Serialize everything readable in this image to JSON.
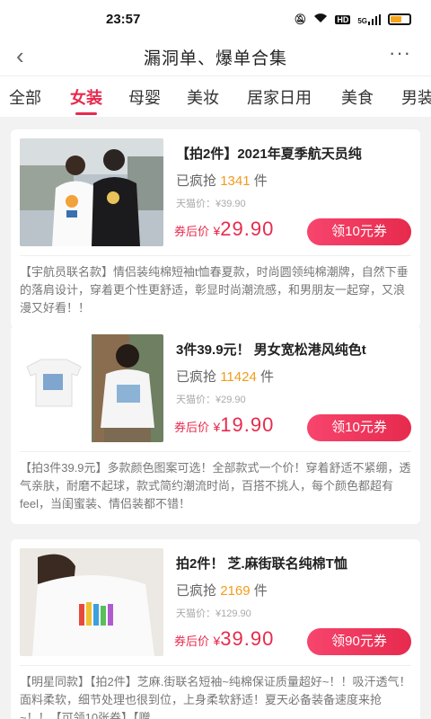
{
  "status": {
    "time": "23:57",
    "icons": [
      "mute-icon",
      "wifi-icon",
      "hd-icon",
      "signal-icon",
      "battery-icon"
    ],
    "hd": "HD",
    "net": "5G",
    "battery_level": 0.6
  },
  "nav": {
    "back": "‹",
    "title": "漏洞单、爆单合集",
    "more": "···"
  },
  "tabs": [
    "全部",
    "女装",
    "母婴",
    "美妆",
    "居家日用",
    "美食",
    "男装"
  ],
  "active_tab": "女装",
  "products": [
    {
      "title": "【拍2件】2021年夏季航天员纯",
      "sold_prefix": "已疯抢",
      "sold_count": "1341",
      "sold_suffix": "件",
      "original_price": "天猫价：¥39.90",
      "price_label": "券后价",
      "currency": "¥",
      "price": "29.90",
      "coupon": "领10元券",
      "desc": "【宇航员联名款】情侣装纯棉短袖t恤春夏款，时尚圆领纯棉潮牌，自然下垂的落肩设计，穿着更个性更舒适，彰显时尚潮流感，和男朋友一起穿，又浪漫又好看！！"
    },
    {
      "title": "3件39.9元！ 男女宽松港风纯色t",
      "sold_prefix": "已疯抢",
      "sold_count": "11424",
      "sold_suffix": "件",
      "original_price": "天猫价：¥29.90",
      "price_label": "券后价",
      "currency": "¥",
      "price": "19.90",
      "coupon": "领10元券",
      "desc": "【拍3件39.9元】多款颜色图案可选！全部款式一个价！穿着舒适不紧绷，透气亲肤，耐磨不起球，款式简约潮流时尚，百搭不挑人，每个颜色都超有feel，当闺蜜装、情侣装都不错！"
    },
    {
      "title": "拍2件！ 芝.麻街联名纯棉T恤",
      "sold_prefix": "已疯抢",
      "sold_count": "2169",
      "sold_suffix": "件",
      "original_price": "天猫价：¥129.90",
      "price_label": "券后价",
      "currency": "¥",
      "price": "39.90",
      "coupon": "领90元券",
      "desc": "【明星同款】【拍2件】芝麻.街联名短袖~纯棉保证质量超好~！！吸汗透气！面料柔软，细节处理也很到位，上身柔软舒适！夏天必备装备速度来抢~！！【可领10张券】【赠"
    }
  ]
}
